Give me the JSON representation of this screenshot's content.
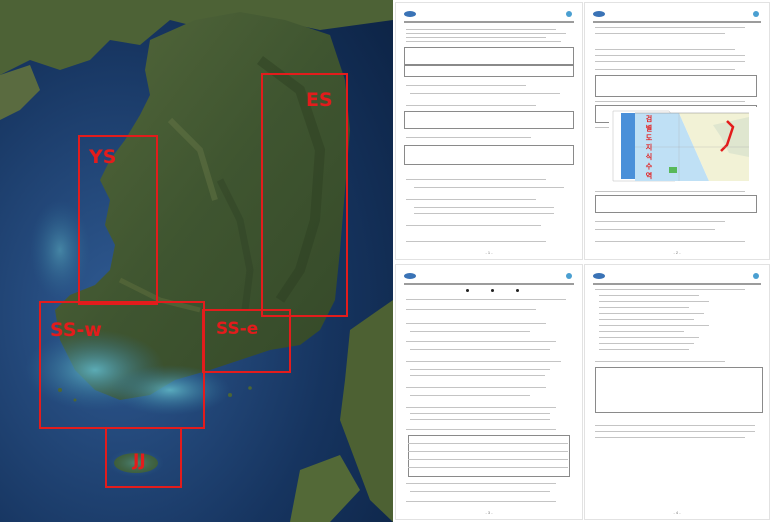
{
  "map": {
    "regions": [
      {
        "id": "ES",
        "label": "ES"
      },
      {
        "id": "YS",
        "label": "YS"
      },
      {
        "id": "SS-w",
        "label": "SS-w"
      },
      {
        "id": "SS-e",
        "label": "SS-e"
      },
      {
        "id": "JJ",
        "label": "JJ"
      }
    ],
    "box_color": "#e31c1c"
  },
  "documents": [
    {
      "id": "page1",
      "page_label": "- 1 -"
    },
    {
      "id": "page2",
      "page_label": "- 2 -"
    },
    {
      "id": "page3",
      "page_label": "- 3 -"
    },
    {
      "id": "page4",
      "page_label": "- 4 -"
    }
  ],
  "inset_map": {
    "label": "검 별 도 지 식 수 역"
  }
}
